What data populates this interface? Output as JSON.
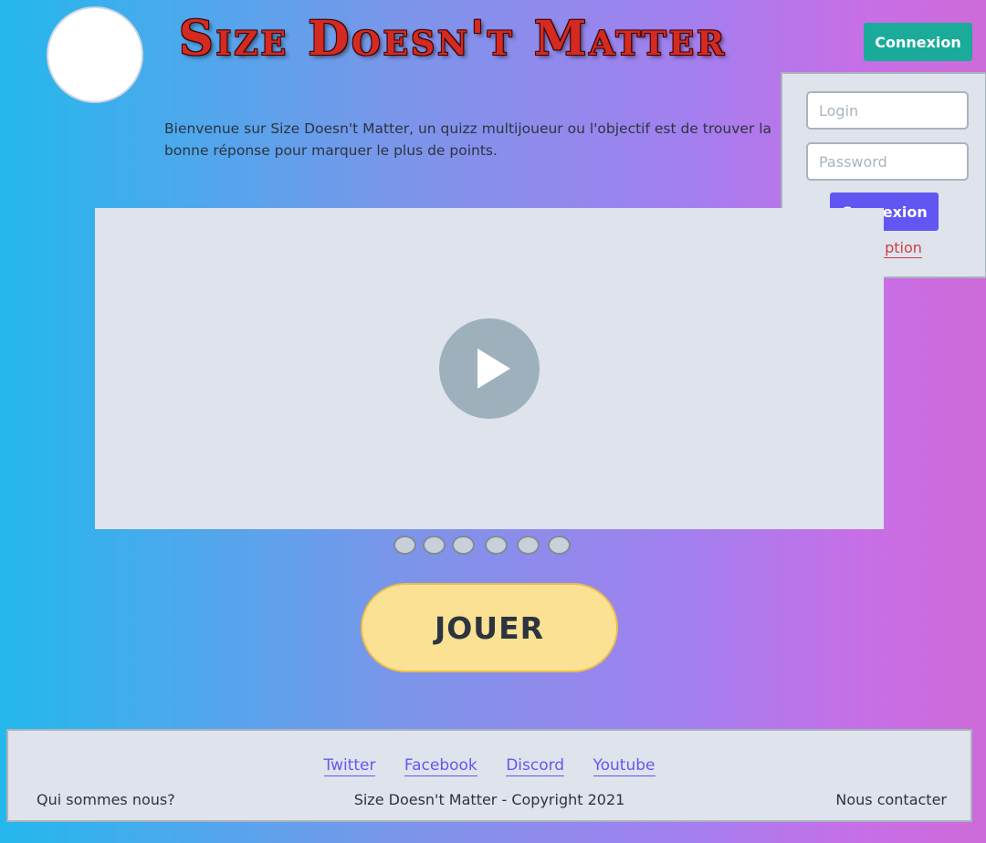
{
  "header": {
    "title": "Size Doesn't Matter",
    "connexion_label": "Connexion"
  },
  "login_panel": {
    "login_placeholder": "Login",
    "password_placeholder": "Password",
    "connexion_label": "Connexion",
    "inscription_label": "Inscription"
  },
  "main": {
    "welcome_text": "Bienvenue sur Size Doesn't Matter, un quizz multijoueur ou l'objectif est  de trouver la bonne réponse pour marquer le plus de points.",
    "play_button_label": "JOUER",
    "carousel_dot_count": 6
  },
  "footer": {
    "links": [
      "Twitter",
      "Facebook",
      "Discord",
      "Youtube"
    ],
    "about_label": "Qui sommes nous?",
    "copyright": "Size Doesn't Matter - Copyright 2021",
    "contact_label": "Nous contacter"
  },
  "colors": {
    "header_connexion_bg": "#1bab9a",
    "panel_connexion_bg": "#6256f3",
    "inscription_link": "#d13f48",
    "footer_link": "#6458f0",
    "play_button_bg": "#fbe193"
  }
}
